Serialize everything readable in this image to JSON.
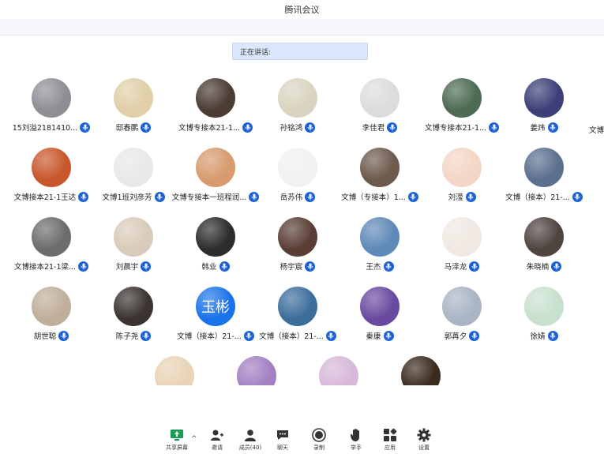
{
  "window": {
    "title": "腾讯会议"
  },
  "speaking": {
    "label": "正在讲话:"
  },
  "participants": [
    {
      "name": "15刘溢2181410...",
      "color": "#8e8f95"
    },
    {
      "name": "邸春鹏",
      "color": "#e0cfa7"
    },
    {
      "name": "文博专接本21-1...",
      "color": "#4b3b33"
    },
    {
      "name": "孙铭鸿",
      "color": "#d9d4c0"
    },
    {
      "name": "李佳君",
      "color": "#dcdcdc"
    },
    {
      "name": "文博专接本21-1...",
      "color": "#4c6b52"
    },
    {
      "name": "姜炜",
      "color": "#3d3f78"
    },
    {
      "name": "文博接本21-1王达",
      "color": "#c8572c"
    },
    {
      "name": "文博1班刘彦芳",
      "color": "#e8e8e8"
    },
    {
      "name": "文博专接本一班程润...",
      "color": "#d79b6e"
    },
    {
      "name": "岳苏伟",
      "color": "#f1f1f1"
    },
    {
      "name": "文博（专接本）1...",
      "color": "#6d5a4c"
    },
    {
      "name": "刘滢",
      "color": "#f3d6c6"
    },
    {
      "name": "文博（接本）21-...",
      "color": "#5b6f8e"
    },
    {
      "name": "文博接本21-1梁...",
      "color": "#6c6c6c"
    },
    {
      "name": "刘晨宇",
      "color": "#d9cbb9"
    },
    {
      "name": "韩业",
      "color": "#2c2c2c"
    },
    {
      "name": "杨宇宸",
      "color": "#5a3e36"
    },
    {
      "name": "王杰",
      "color": "#5f89b8"
    },
    {
      "name": "马泽龙",
      "color": "#f0e8e2"
    },
    {
      "name": "朱晓楠",
      "color": "#4f4440"
    },
    {
      "name": "胡世聪",
      "color": "#bfae9a"
    },
    {
      "name": "陈子尧",
      "color": "#3a3330"
    },
    {
      "name": "文博（接本）21-...",
      "color": "#1a73e8",
      "avatar_text": "玉彬"
    },
    {
      "name": "文博（接本）21-...",
      "color": "#3c6e9c"
    },
    {
      "name": "秦康",
      "color": "#6a4aa0"
    },
    {
      "name": "郭苒夕",
      "color": "#a9b5c5"
    },
    {
      "name": "徐婧",
      "color": "#c8e0cf"
    },
    {
      "name": "",
      "color": "#e8d3b5"
    },
    {
      "name": "",
      "color": "#a280c2"
    },
    {
      "name": "",
      "color": "#d6b8d8"
    },
    {
      "name": "",
      "color": "#3b2a1e"
    }
  ],
  "edge_name": "文博",
  "toolbar": {
    "share": "共享屏幕",
    "invite": "邀请",
    "members": "成员(40)",
    "chat": "聊天",
    "record": "录制",
    "raise": "举手",
    "apps": "应用",
    "settings": "设置"
  }
}
